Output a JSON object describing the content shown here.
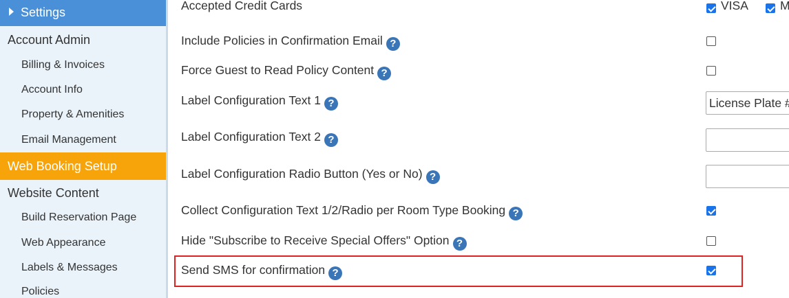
{
  "sidebar": {
    "header": "Settings",
    "items": [
      {
        "label": "Account Admin",
        "level": "top"
      },
      {
        "label": "Billing & Invoices",
        "level": "sub"
      },
      {
        "label": "Account Info",
        "level": "sub"
      },
      {
        "label": "Property & Amenities",
        "level": "sub"
      },
      {
        "label": "Email Management",
        "level": "sub"
      },
      {
        "label": "Web Booking Setup",
        "level": "top",
        "active": true
      },
      {
        "label": "Website Content",
        "level": "top"
      },
      {
        "label": "Build Reservation Page",
        "level": "sub"
      },
      {
        "label": "Web Appearance",
        "level": "sub"
      },
      {
        "label": "Labels & Messages",
        "level": "sub"
      },
      {
        "label": "Policies",
        "level": "sub"
      }
    ]
  },
  "settings": {
    "accepted_cards": {
      "label": "Accepted Credit Cards",
      "cards": [
        {
          "name": "VISA",
          "checked": true
        },
        {
          "name": "M",
          "checked": true
        }
      ]
    },
    "include_policies": {
      "label": "Include Policies in Confirmation Email",
      "checked": false
    },
    "force_read_policy": {
      "label": "Force Guest to Read Policy Content",
      "checked": false
    },
    "label_text_1": {
      "label": "Label Configuration Text 1",
      "value": "License Plate #"
    },
    "label_text_2": {
      "label": "Label Configuration Text 2",
      "value": ""
    },
    "label_radio": {
      "label": "Label Configuration Radio Button (Yes or No)",
      "value": ""
    },
    "collect_per_room": {
      "label": "Collect Configuration Text 1/2/Radio per Room Type Booking",
      "checked": true
    },
    "hide_subscribe": {
      "label": "Hide \"Subscribe to Receive Special Offers\" Option",
      "checked": false
    },
    "send_sms": {
      "label": "Send SMS for confirmation",
      "checked": true
    }
  },
  "help_glyph": "?",
  "colors": {
    "sidebar_bg": "#eaf3fa",
    "header_blue": "#4a90d9",
    "active_orange": "#f7a30a",
    "help_blue": "#3a75b8",
    "highlight_red": "#dd2222"
  }
}
